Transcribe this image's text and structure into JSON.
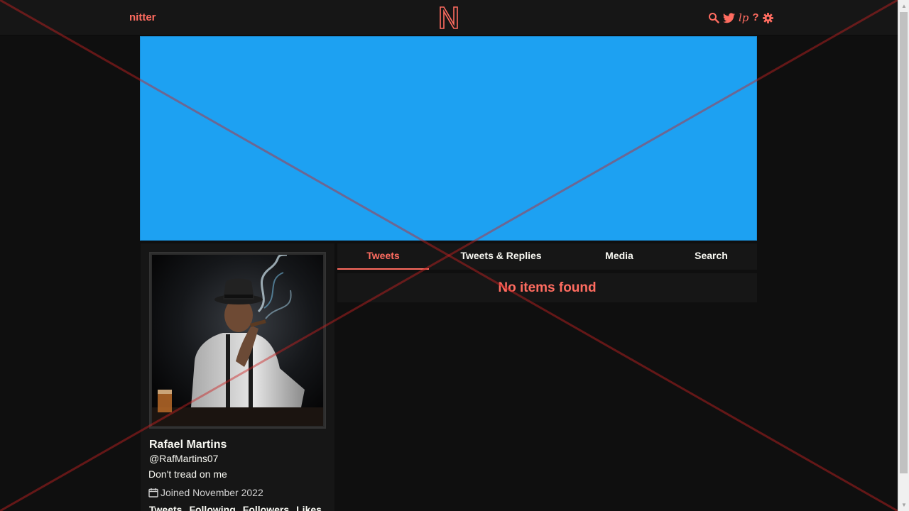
{
  "nav": {
    "brand": "nitter",
    "icons": [
      "search-icon",
      "twitter-bird-icon",
      "lp-icon",
      "help-icon",
      "settings-gear-icon"
    ],
    "lp_label": "lp",
    "help_label": "?"
  },
  "profile": {
    "fullname": "Rafael Martins",
    "username": "@RafMartins07",
    "bio": "Don't tread on me",
    "joined": "Joined November 2022",
    "stats": [
      "Tweets",
      "Following",
      "Followers",
      "Likes"
    ]
  },
  "tabs": [
    "Tweets",
    "Tweets & Replies",
    "Media",
    "Search"
  ],
  "active_tab": "Tweets",
  "timeline": {
    "empty_message": "No items found"
  },
  "colors": {
    "accent": "#ff6c60",
    "banner": "#1da1f2",
    "background": "#0f0f0f",
    "panel": "#161616"
  }
}
